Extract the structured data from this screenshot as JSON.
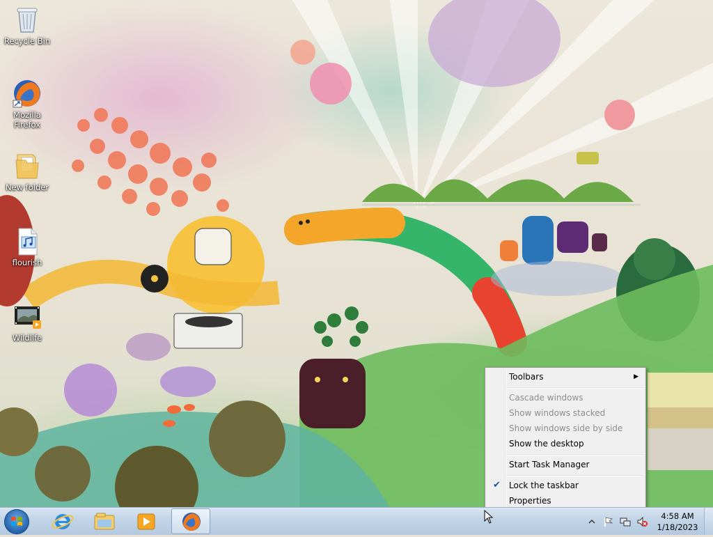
{
  "desktop": {
    "icons": [
      {
        "label": "Recycle Bin"
      },
      {
        "label": "Mozilla Firefox"
      },
      {
        "label": "New folder"
      },
      {
        "label": "flourish"
      },
      {
        "label": "Wildlife"
      }
    ]
  },
  "context_menu": {
    "items": [
      {
        "label": "Toolbars",
        "disabled": false,
        "submenu": true
      },
      {
        "label": "Cascade windows",
        "disabled": true
      },
      {
        "label": "Show windows stacked",
        "disabled": true
      },
      {
        "label": "Show windows side by side",
        "disabled": true
      },
      {
        "label": "Show the desktop",
        "disabled": false
      },
      {
        "label": "Start Task Manager",
        "disabled": false
      },
      {
        "label": "Lock the taskbar",
        "disabled": false,
        "checked": true
      },
      {
        "label": "Properties",
        "disabled": false
      }
    ]
  },
  "taskbar": {
    "pinned": [
      {
        "icon": "internet-explorer-icon"
      },
      {
        "icon": "windows-explorer-icon"
      },
      {
        "icon": "media-player-icon"
      },
      {
        "icon": "firefox-icon",
        "active": true
      }
    ],
    "tray_icons": [
      "show-hidden-icons-icon",
      "action-center-flag-icon",
      "network-icon",
      "volume-muted-icon"
    ],
    "clock": {
      "time": "4:58 AM",
      "date": "1/18/2023"
    }
  },
  "colors": {
    "taskbar": "#c3d5e8",
    "menu_bg": "#f0f0f0",
    "accent": "#1b4fa8"
  }
}
